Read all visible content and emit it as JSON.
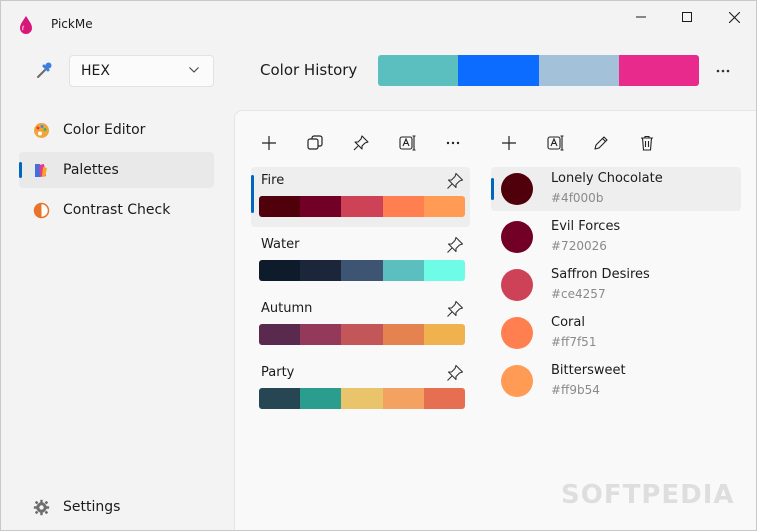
{
  "window": {
    "title": "PickMe"
  },
  "toolbar": {
    "format_value": "HEX",
    "history_label": "Color History",
    "history_colors": [
      "#5cbfbf",
      "#0b6cff",
      "#a3c1d9",
      "#e72a8c"
    ]
  },
  "sidebar": {
    "items": [
      {
        "label": "Color Editor",
        "icon": "palette-icon"
      },
      {
        "label": "Palettes",
        "icon": "palettes-icon"
      },
      {
        "label": "Contrast Check",
        "icon": "contrast-icon"
      }
    ],
    "settings_label": "Settings"
  },
  "palettes": [
    {
      "name": "Fire",
      "colors": [
        "#4f000b",
        "#720026",
        "#ce4257",
        "#ff7f51",
        "#ff9b54"
      ]
    },
    {
      "name": "Water",
      "colors": [
        "#0d1b2a",
        "#1b263b",
        "#3e5473",
        "#5cbfbf",
        "#6ffce6"
      ]
    },
    {
      "name": "Autumn",
      "colors": [
        "#5a2a4e",
        "#94395a",
        "#c25658",
        "#e4834f",
        "#f0b24f"
      ]
    },
    {
      "name": "Party",
      "colors": [
        "#264653",
        "#2a9d8f",
        "#e9c46a",
        "#f4a261",
        "#e76f51"
      ]
    }
  ],
  "colors": [
    {
      "name": "Lonely Chocolate",
      "hex": "#4f000b"
    },
    {
      "name": "Evil Forces",
      "hex": "#720026"
    },
    {
      "name": "Saffron Desires",
      "hex": "#ce4257"
    },
    {
      "name": "Coral",
      "hex": "#ff7f51"
    },
    {
      "name": "Bittersweet",
      "hex": "#ff9b54"
    }
  ],
  "watermark": "SOFTPEDIA",
  "accent": "#0067c0"
}
